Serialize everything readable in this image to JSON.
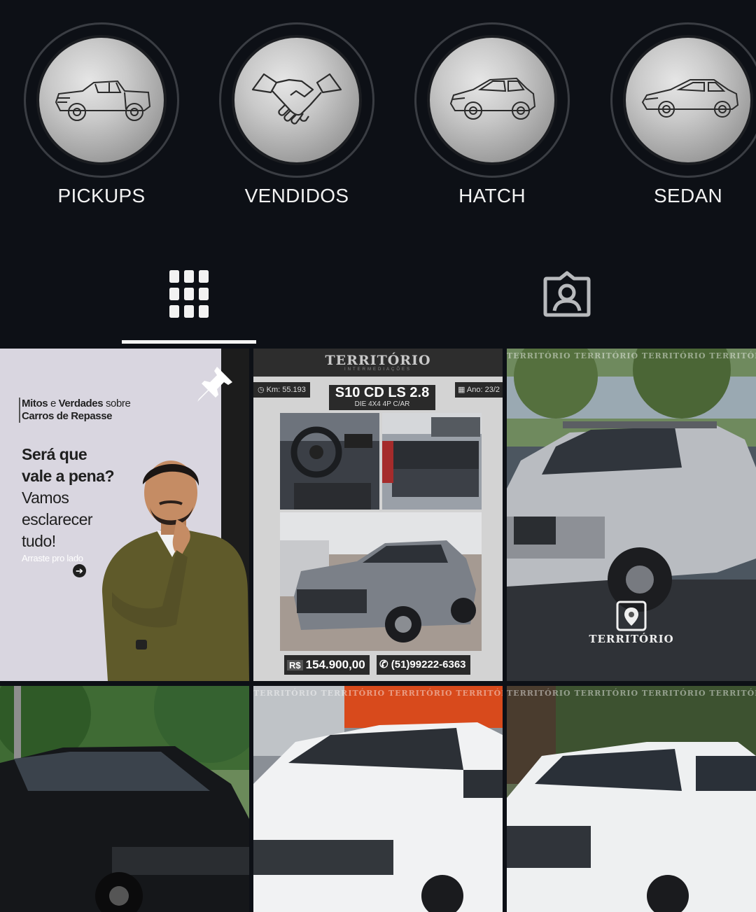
{
  "highlights": [
    {
      "label": "PICKUPS",
      "icon": "pickup-truck-icon"
    },
    {
      "label": "VENDIDOS",
      "icon": "handshake-icon"
    },
    {
      "label": "HATCH",
      "icon": "hatchback-car-icon"
    },
    {
      "label": "SEDAN",
      "icon": "sedan-car-icon"
    }
  ],
  "tabs": [
    {
      "name": "posts-grid",
      "icon": "grid-icon",
      "active": true
    },
    {
      "name": "tagged",
      "icon": "tagged-person-icon",
      "active": false
    }
  ],
  "posts": {
    "post1": {
      "title_prefix_bold_1": "Mitos",
      "title_prefix_mid": " e ",
      "title_prefix_bold_2": "Verdades",
      "title_suffix": " sobre",
      "title_line2": "Carros de Repasse",
      "headline_bold_1": "Será que",
      "headline_bold_2": "vale a pena?",
      "headline_3": "Vamos",
      "headline_4": "esclarecer",
      "headline_5": "tudo!",
      "swipe_hint": "Arraste pro lado",
      "pinned": true
    },
    "post2": {
      "brand": "TERRITÓRIO",
      "brand_sub": "INTERMEDIAÇÕES",
      "km": "Km: 55.193",
      "year": "Ano: 23/2",
      "model": "S10 CD LS 2.8",
      "model_sub": "DIE 4X4 4P C/AR",
      "price_currency": "R$",
      "price": "154.900,00",
      "phone": "(51)99222-6363"
    },
    "post3": {
      "watermark": "TERRITÓRIO"
    },
    "watermark_strip": "TERRITÓRIO TERRITÓRIO TERRITÓRIO TERRITÓRIO TERRITÓRIO"
  },
  "colors": {
    "background": "#0d1016",
    "text": "#f2f2f2",
    "ring": "#3a3d43"
  }
}
